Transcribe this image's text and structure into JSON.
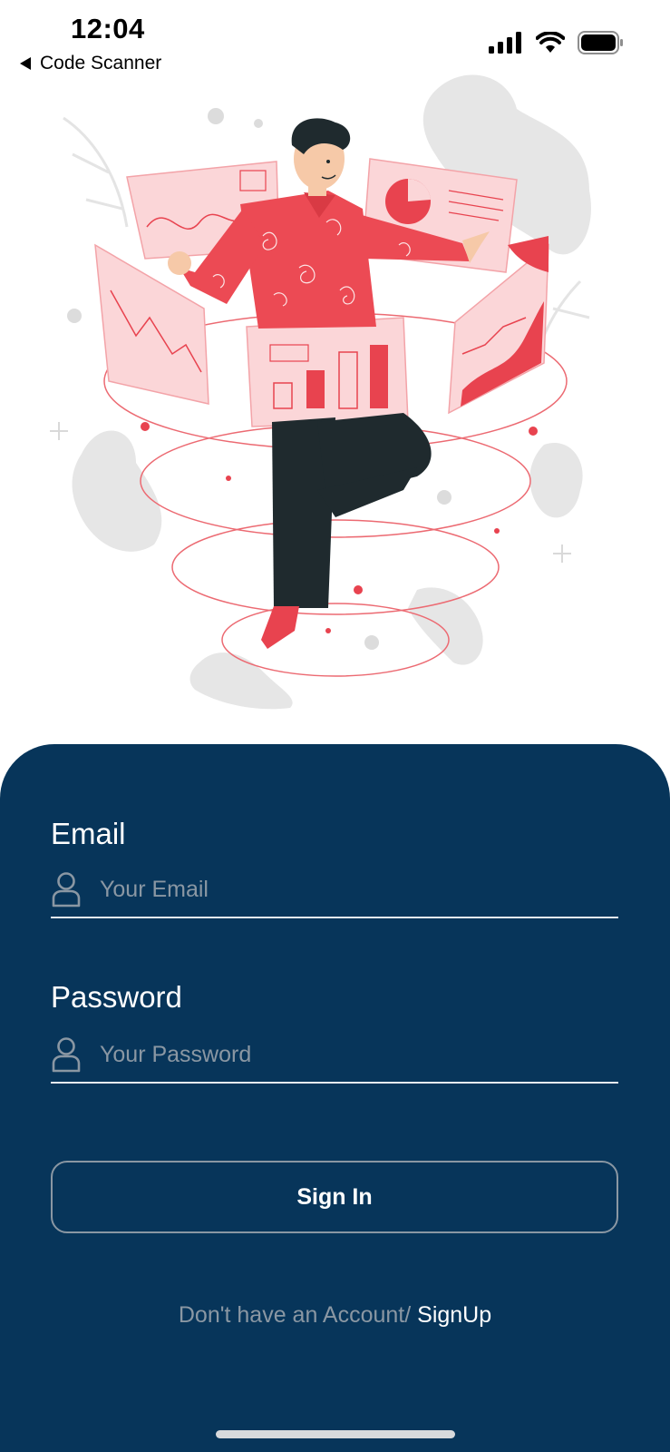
{
  "status_bar": {
    "time": "12:04",
    "back_label": "Code Scanner",
    "icons": [
      "cellular-signal-icon",
      "wifi-icon",
      "battery-icon"
    ]
  },
  "illustration": {
    "subject": "person-with-floating-charts-illustration",
    "colors": {
      "accent": "#e8434f",
      "light_accent": "#fbd6d8",
      "dark": "#1f2a2e",
      "shirt": "#ec4a54",
      "skin": "#f6c9a8",
      "hair": "#1f2a2e",
      "decor_gray": "#e4e4e4"
    }
  },
  "form": {
    "email": {
      "label": "Email",
      "placeholder": "Your Email",
      "value": ""
    },
    "password": {
      "label": "Password",
      "placeholder": "Your Password",
      "value": ""
    },
    "sign_in_label": "Sign In",
    "signup_prompt": "Don't have an Account/ ",
    "signup_link": "SignUp"
  },
  "colors": {
    "panel_background": "#07355a",
    "placeholder_text": "#8a97a3",
    "button_border": "#8a97a3",
    "text_primary": "#ffffff"
  }
}
